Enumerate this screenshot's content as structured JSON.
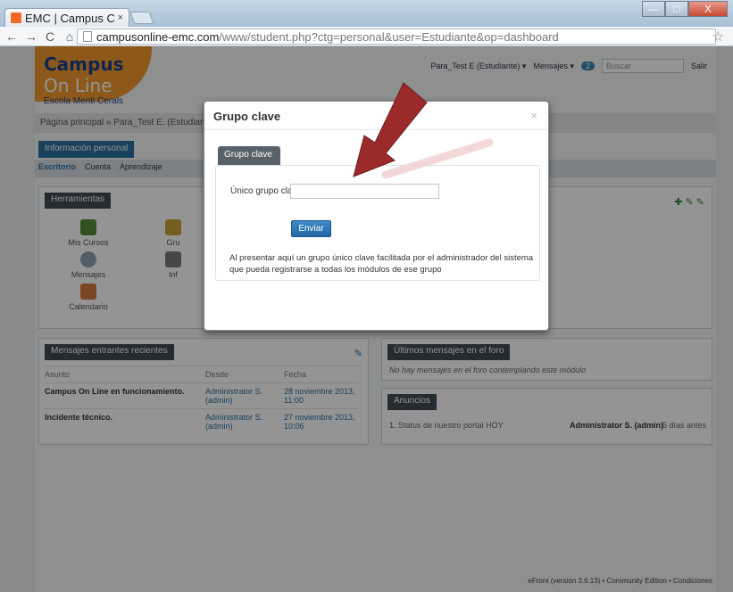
{
  "browser": {
    "tab_title": "EMC | Campus C",
    "tab_close": "×",
    "url_host": "campusonline-emc.com",
    "url_path": "/www/student.php?ctg=personal&user=Estudiante&op=dashboard",
    "nav": {
      "back": "←",
      "forward": "→",
      "reload": "C",
      "home": "⌂"
    },
    "star": "☆",
    "window": {
      "minimize": "—",
      "maximize": "□",
      "close": "X"
    }
  },
  "site": {
    "logo_main": "Campus",
    "logo_accent": "On Line",
    "logo_sub": "Escola Menti Cerals",
    "user_menu": "Para_Test E (Estudiante) ▾",
    "messages_menu": "Mensajes ▾",
    "messages_count": "2",
    "search_placeholder": "Buscar",
    "logout": "Salir",
    "breadcrumb": "Página principal » Para_Test E. (Estudiante)",
    "section_tab": "Información personal",
    "subtabs": [
      "Escritorio",
      "Cuenta",
      "Aprendizaje"
    ],
    "tools_title": "Herramientas",
    "tools": [
      "Mis Cursos",
      "Gru",
      "Mensajes",
      "Inf",
      "Calendario"
    ],
    "recent_title": "Mensajes entrantes recientes",
    "table_headers": [
      "Asunto",
      "Desde",
      "Fecha"
    ],
    "rows": [
      {
        "subject": "Campus On Line en funcionamiento.",
        "from": "Administrator S. (admin)",
        "date": "28 noviembre 2013, 11:00"
      },
      {
        "subject": "Incidente técnico.",
        "from": "Administrator S. (admin)",
        "date": "27 noviembre 2013, 10:06"
      }
    ],
    "forum_title": "Últimos mensajes en el foro",
    "forum_empty": "No hay mensajes en el foro contemplando este módulo",
    "news_title": "Anuncios",
    "news_item": "1. Status de nuestro portal HOY",
    "news_author": "Administrator S. (admin)",
    "news_when": "5 días antes",
    "footer": "eFront (version 3.6.13) • Community Edition • Condiciones"
  },
  "modal": {
    "title": "Grupo clave",
    "close": "×",
    "tab": "Grupo clave",
    "label": "Único grupo clave:",
    "input_value": "",
    "submit": "Enviar",
    "help": "Al presentar aquí un grupo único clave facilitada por el administrador del sistema que pueda registrarse a todas los módulos de ese grupo"
  },
  "colors": {
    "accent": "#2b6fa0",
    "arrow": "#9b2b2b",
    "logo": "#f29a2e"
  }
}
